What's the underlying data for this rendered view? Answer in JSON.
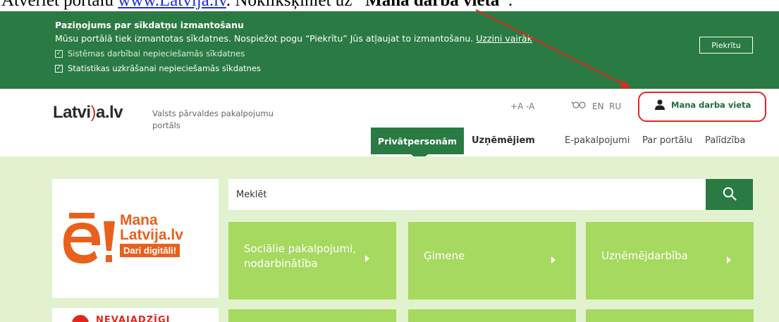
{
  "instruction": {
    "prefix": "Atveriet portālu ",
    "link": "www.Latvija.lv",
    "middle": ". Noklikšķiniet uz ",
    "target": "Mana darba vieta",
    "suffix": "."
  },
  "cookie_banner": {
    "title": "Paziņojums par sīkdatņu izmantošanu",
    "text": "Mūsu portālā tiek izmantotas sīkdatnes. Nospiežot pogu “Piekrītu” Jūs atļaujat to izmantošanu. ",
    "more_link": "Uzzini vairāk",
    "checkbox_system": "Sistēmas darbībai nepieciešamās sīkdatnes",
    "checkbox_stats": "Statistikas uzkrāšanai nepieciešamās sīkdatnes",
    "accept_label": "Piekrītu",
    "background_color": "#2a7a43"
  },
  "header": {
    "logo_part1": "Latvi",
    "logo_paren": ")",
    "logo_part2": "a.lv",
    "tagline": "Valsts pārvaldes pakalpojumu portāls",
    "font_plus": "+A",
    "font_minus": "-A",
    "glasses_icon": "glasses-icon",
    "lang_en": "EN",
    "lang_ru": "RU",
    "workplace_label": "Mana darba vieta"
  },
  "nav": {
    "private": "Privātpersonām",
    "business": "Uzņēmējiem",
    "eservices": "E-pakalpojumi",
    "about": "Par portālu",
    "help": "Palīdzība"
  },
  "promo": {
    "line1": "Mana",
    "line2": "Latvija.lv",
    "line3": "Dari digitāli!",
    "accent_color": "#e8601c",
    "second_text": "NEVAJADZĪGI"
  },
  "search": {
    "placeholder": "Meklēt",
    "icon": "search-icon"
  },
  "tiles": [
    {
      "label": "Sociālie pakalpojumi, nodarbinātība"
    },
    {
      "label": "Ģimene"
    },
    {
      "label": "Uzņēmējdarbība"
    }
  ],
  "colors": {
    "primary_green": "#2a7a43",
    "tile_green": "#a6d95f",
    "page_bg": "#e2f2cf",
    "annotation_red": "#e8241f"
  }
}
